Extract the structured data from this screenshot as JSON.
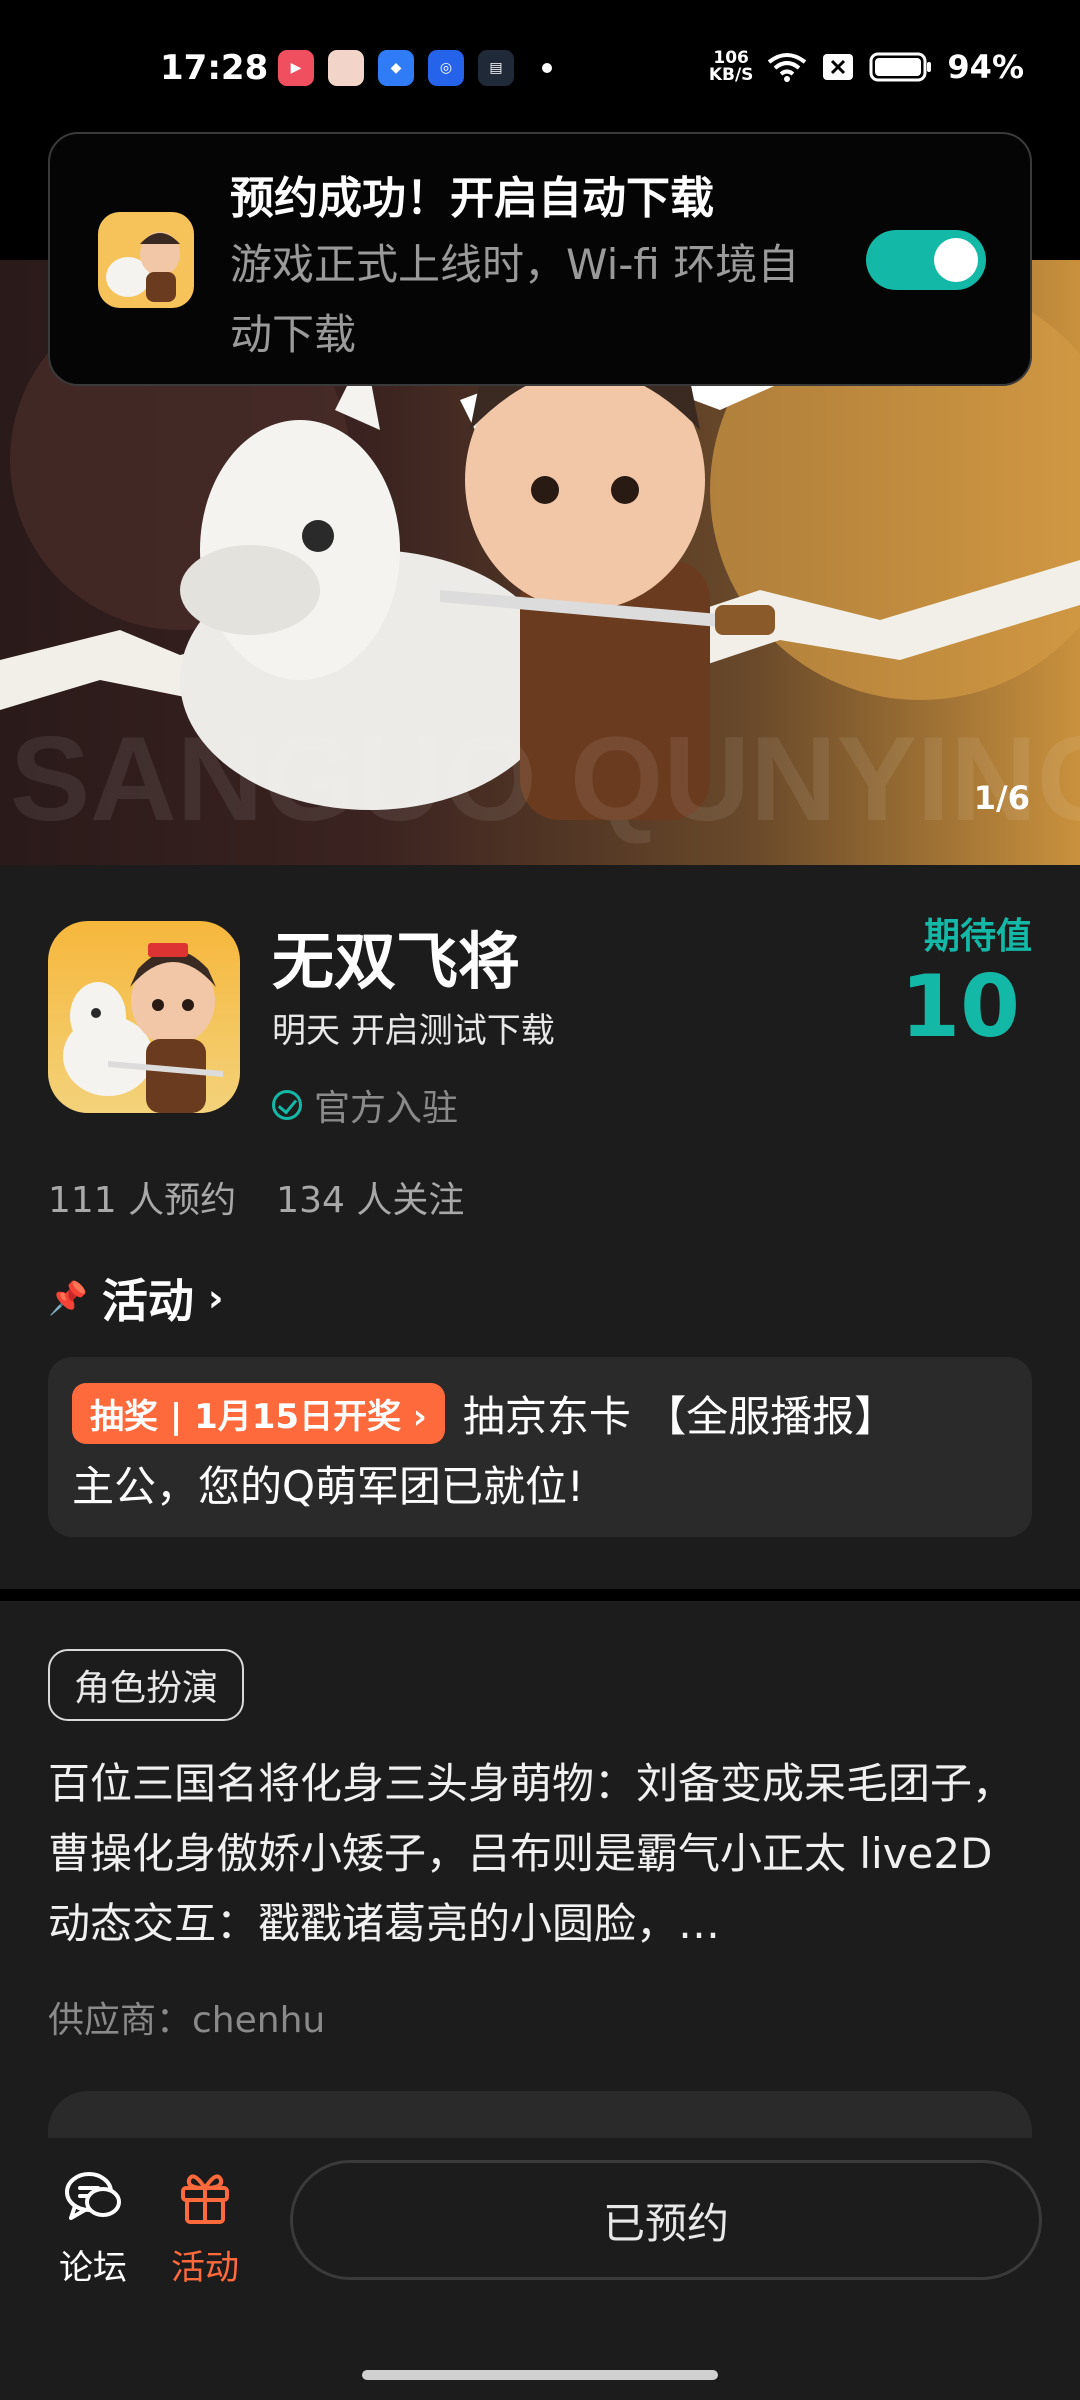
{
  "status_bar": {
    "time": "17:28",
    "net_speed_value": "106",
    "net_speed_unit": "KB/S",
    "battery_pct": "94%"
  },
  "notification": {
    "title": "预约成功！开启自动下载",
    "body": "游戏正式上线时，Wi-fi 环境自动下载",
    "toggle_on": true,
    "colors": {
      "toggle": "#14b8a6"
    }
  },
  "hero": {
    "counter": "1/6"
  },
  "game": {
    "name": "无双飞将",
    "subtitle": "明天 开启测试下载",
    "official": "官方入驻",
    "expect_label": "期待值",
    "expect_value": "10",
    "reserved_count": "111 人预约",
    "follow_count": "134 人关注"
  },
  "activity": {
    "heading": "活动",
    "badge": "抽奖 | 1月15日开奖 ›",
    "line1": "抽京东卡 【全服播报】",
    "line2": "主公，您的Q萌军团已就位!"
  },
  "description": {
    "tag": "角色扮演",
    "text": "百位三国名将化身三头身萌物：刘备变成呆毛团子，曹操化身傲娇小矮子，吕布则是霸气小正太 live2D动态交互：戳戳诸葛亮的小圆脸，…",
    "supplier": "供应商：chenhu"
  },
  "bottom_bar": {
    "forum_label": "论坛",
    "activity_label": "活动",
    "reserved_button": "已预约",
    "colors": {
      "active": "#ff6a3d"
    }
  }
}
